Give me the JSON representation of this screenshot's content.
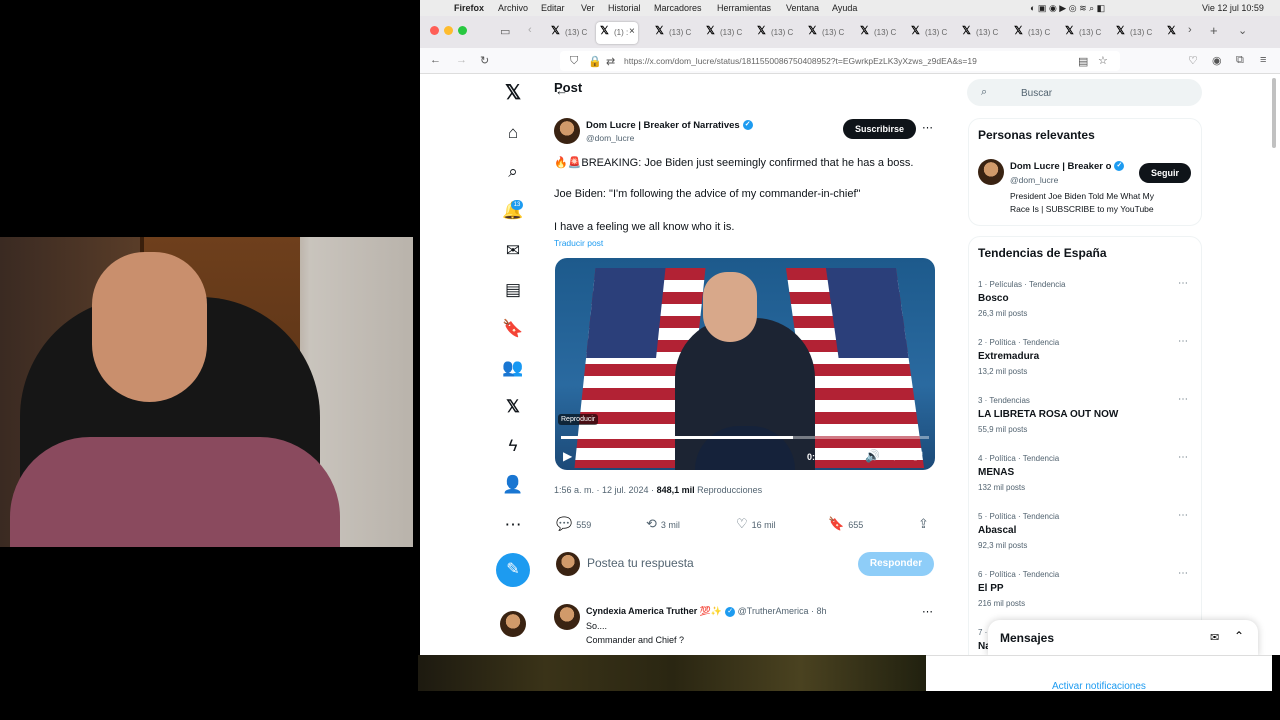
{
  "menubar": {
    "app": "Firefox",
    "items": [
      "Archivo",
      "Editar",
      "Ver",
      "Historial",
      "Marcadores",
      "Herramientas",
      "Ventana",
      "Ayuda"
    ],
    "clock": "Vie 12 jul 10:59"
  },
  "browser": {
    "tab_title": "(13) C",
    "active_tab_title": "(1) :",
    "url": "https://x.com/dom_lucre/status/1811550086750408952?t=EGwrkpEzLK3yXzws_z9dEA&s=19"
  },
  "x_app": {
    "nav_badge": "13",
    "post_header": "Post",
    "post": {
      "author_name": "Dom Lucre | Breaker of Narratives",
      "author_handle": "@dom_lucre",
      "subscribe_label": "Suscribirse",
      "line1": "🔥🚨BREAKING: Joe Biden just seemingly confirmed that he has a boss.",
      "line2": "Joe Biden: \"I'm following the advice of my commander-in-chief\"",
      "line3": "I have a feeling we all know who it is.",
      "translate": "Traducir post",
      "video": {
        "reproducir": "Reproducir",
        "time": "0:07 / 0:12",
        "progress": 0.63
      },
      "timestamp": "1:56 a. m. · 12 jul. 2024 · ",
      "views_count": "848,1 mil",
      "views_label": " Reproducciones",
      "actions": {
        "replies": "559",
        "reposts": "3 mil",
        "likes": "16 mil",
        "bookmarks": "655"
      }
    },
    "reply_box": {
      "placeholder": "Postea tu respuesta",
      "button": "Responder"
    },
    "reply": {
      "author_name": "Cyndexia America Truther 💯✨",
      "author_handle": "@TrutherAmerica · 8h",
      "line1": "So....",
      "line2": "Commander and Chief ?"
    },
    "search_placeholder": "Buscar",
    "relevant": {
      "title": "Personas relevantes",
      "name": "Dom Lucre | Breaker o",
      "handle": "@dom_lucre",
      "follow_label": "Seguir",
      "bio_line1": "President Joe Biden Told Me What My",
      "bio_line2": "Race Is | SUBSCRIBE to my YouTube"
    },
    "trends_title": "Tendencias de España",
    "trends": [
      {
        "meta": "1 · Películas · Tendencia",
        "name": "Bosco",
        "count": "26,3 mil posts"
      },
      {
        "meta": "2 · Política · Tendencia",
        "name": "Extremadura",
        "count": "13,2 mil posts"
      },
      {
        "meta": "3 · Tendencias",
        "name": "LA LIBRETA ROSA OUT NOW",
        "count": "55,9 mil posts"
      },
      {
        "meta": "4 · Política · Tendencia",
        "name": "MENAS",
        "count": "132 mil posts"
      },
      {
        "meta": "5 · Política · Tendencia",
        "name": "Abascal",
        "count": "92,3 mil posts"
      },
      {
        "meta": "6 · Política · Tendencia",
        "name": "El PP",
        "count": "216 mil posts"
      },
      {
        "meta": "7 ·",
        "name": "Na",
        "count": ""
      }
    ],
    "messages_title": "Mensajes"
  },
  "notification": {
    "link": "Activar notificaciones"
  }
}
